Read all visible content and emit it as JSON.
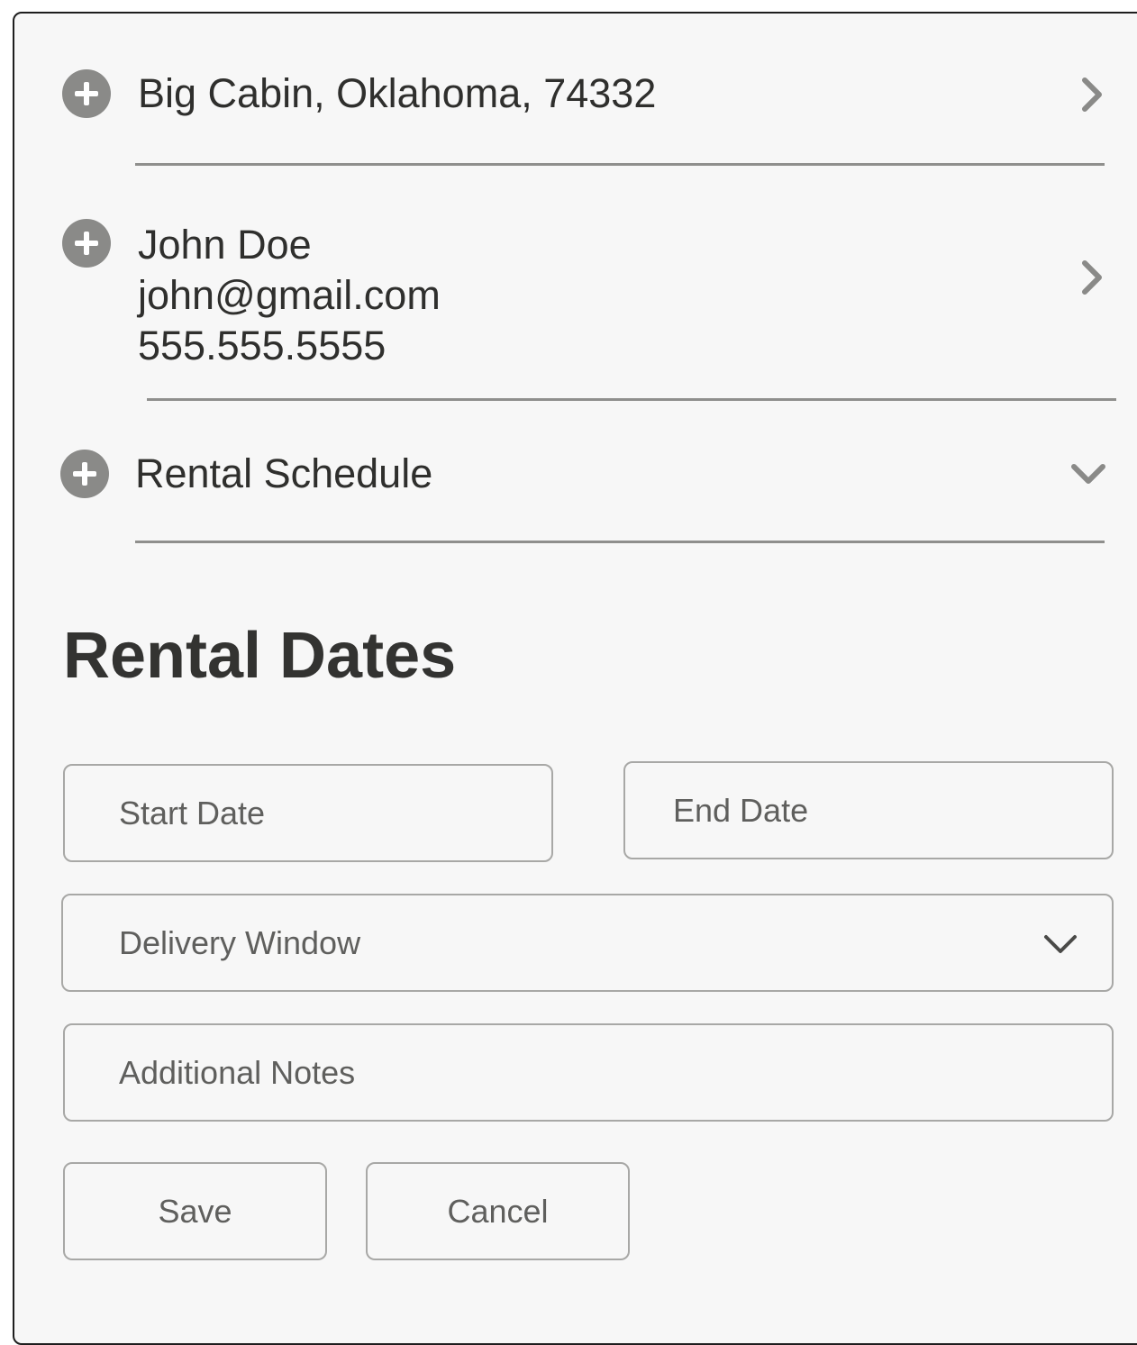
{
  "location": {
    "text": "Big Cabin, Oklahoma, 74332",
    "expand_icon": "plus-circle-icon",
    "nav_icon": "chevron-right-icon"
  },
  "contact": {
    "name": "John Doe",
    "email": "john@gmail.com",
    "phone": "555.555.5555",
    "expand_icon": "plus-circle-icon",
    "nav_icon": "chevron-right-icon"
  },
  "schedule": {
    "label": "Rental Schedule",
    "expand_icon": "plus-circle-icon",
    "toggle_icon": "chevron-down-icon"
  },
  "rental_dates": {
    "title": "Rental Dates",
    "start_date_placeholder": "Start Date",
    "end_date_placeholder": "End Date",
    "delivery_window_placeholder": "Delivery Window",
    "notes_placeholder": "Additional Notes",
    "save_label": "Save",
    "cancel_label": "Cancel"
  },
  "colors": {
    "panel_background": "#f7f7f7",
    "icon_gray": "#8a8a88",
    "text_dark": "#2f2f2d",
    "field_border": "#a8a8a6",
    "placeholder_text": "#5f5f5d"
  }
}
